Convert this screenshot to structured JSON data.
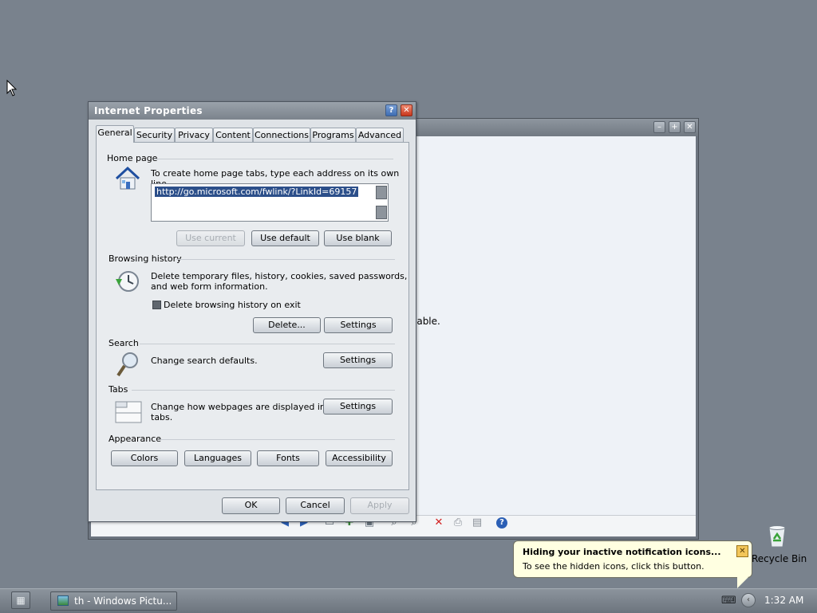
{
  "desktop": {
    "recycle_bin_label": "Recycle Bin"
  },
  "background_window": {
    "partial_text": "lable."
  },
  "dialog": {
    "title": "Internet Properties",
    "tabs": [
      "General",
      "Security",
      "Privacy",
      "Content",
      "Connections",
      "Programs",
      "Advanced"
    ],
    "active_tab": "General",
    "home_page": {
      "heading": "Home page",
      "description": "To create home page tabs, type each address on its own line.",
      "url_value": "http://go.microsoft.com/fwlink/?LinkId=69157",
      "use_current_label": "Use current",
      "use_default_label": "Use default",
      "use_blank_label": "Use blank"
    },
    "browsing_history": {
      "heading": "Browsing history",
      "description_line1": "Delete temporary files, history, cookies, saved passwords,",
      "description_line2": "and web form information.",
      "checkbox_label": "Delete browsing history on exit",
      "delete_label": "Delete...",
      "settings_label": "Settings"
    },
    "search": {
      "heading": "Search",
      "description": "Change search defaults.",
      "settings_label": "Settings"
    },
    "tabs_section": {
      "heading": "Tabs",
      "description_line1": "Change how webpages are displayed in",
      "description_line2": "tabs.",
      "settings_label": "Settings"
    },
    "appearance": {
      "heading": "Appearance",
      "colors_label": "Colors",
      "languages_label": "Languages",
      "fonts_label": "Fonts",
      "accessibility_label": "Accessibility"
    },
    "footer": {
      "ok_label": "OK",
      "cancel_label": "Cancel",
      "apply_label": "Apply"
    }
  },
  "balloon": {
    "title": "Hiding your inactive notification icons...",
    "text": "To see the hidden icons, click this button."
  },
  "taskbar": {
    "task_label": "th - Windows Pictu...",
    "clock": "1:32 AM"
  }
}
